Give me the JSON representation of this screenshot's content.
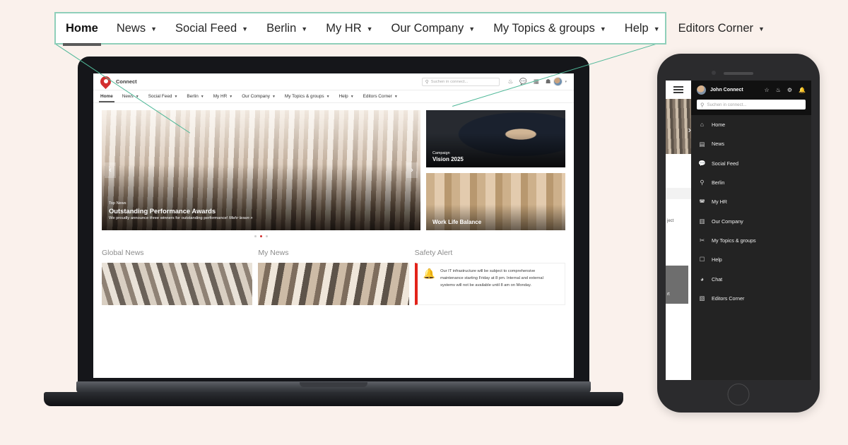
{
  "theme": {
    "page_background": "#faf1ec",
    "callout_border": "#8fcfba",
    "leader_line": "#4fb898",
    "brand_red": "#d32f2f",
    "alert_red": "#e2231a"
  },
  "callout_nav": {
    "items": [
      {
        "label": "Home",
        "caret": "",
        "active": true
      },
      {
        "label": "News",
        "caret": "▼",
        "active": false
      },
      {
        "label": "Social Feed",
        "caret": "▼",
        "active": false
      },
      {
        "label": "Berlin",
        "caret": "▼",
        "active": false
      },
      {
        "label": "My HR",
        "caret": "▼",
        "active": false
      },
      {
        "label": "Our Company",
        "caret": "▼",
        "active": false
      },
      {
        "label": "My Topics & groups",
        "caret": "▼",
        "active": false
      },
      {
        "label": "Help",
        "caret": "▼",
        "active": false
      },
      {
        "label": "Editors Corner",
        "caret": "▼",
        "active": false
      }
    ]
  },
  "desktop": {
    "header": {
      "brand": "Connect",
      "logo_icon": "location-pin-icon",
      "search_placeholder": "Suchen in connect...",
      "search_icon": "search-icon",
      "icons": [
        {
          "name": "people-icon",
          "glyph": "⚇"
        },
        {
          "name": "chat-icon",
          "glyph": "○"
        },
        {
          "name": "apps-grid-icon",
          "glyph": "∷"
        },
        {
          "name": "bookmark-icon",
          "glyph": "⌂"
        }
      ],
      "avatar_caret": "▾"
    },
    "nav": {
      "items": [
        {
          "label": "Home",
          "caret": "",
          "active": true
        },
        {
          "label": "News",
          "caret": "▼",
          "active": false
        },
        {
          "label": "Social Feed",
          "caret": "▼",
          "active": false
        },
        {
          "label": "Berlin",
          "caret": "▼",
          "active": false
        },
        {
          "label": "My HR",
          "caret": "▼",
          "active": false
        },
        {
          "label": "Our Company",
          "caret": "▼",
          "active": false
        },
        {
          "label": "My Topics & groups",
          "caret": "▼",
          "active": false
        },
        {
          "label": "Help",
          "caret": "▼",
          "active": false
        },
        {
          "label": "Editors Corner",
          "caret": "▼",
          "active": false
        }
      ]
    },
    "hero": {
      "prev_arrow": "‹",
      "next_arrow": "›",
      "kicker": "Top News",
      "title": "Outstanding Performance Awards",
      "subtitle": "We proudly announce three winners for outstanding performance!",
      "link": "Mehr lesen »",
      "dots": 3,
      "active_dot": 1
    },
    "cards": [
      {
        "kicker": "Campaign",
        "title": "Vision 2025"
      },
      {
        "kicker": "",
        "title": "Work Life Balance"
      }
    ],
    "sections": [
      {
        "heading": "Global News"
      },
      {
        "heading": "My News"
      },
      {
        "heading": "Safety Alert"
      }
    ],
    "safety_alert": {
      "icon": "bell-icon",
      "text": "Our IT infrastructure will be subject to comprehensive maintenance starting Friday at 8 pm. Internal and external systems will not be available until 8 am on Monday."
    }
  },
  "mobile": {
    "hamburger_icon": "hamburger-menu-icon",
    "behind_text": "ject",
    "behind_dark_text": "rt",
    "behind_chevron": "›",
    "topbar": {
      "avatar": "user-avatar",
      "user": "John Connect",
      "icons": [
        {
          "name": "star-icon",
          "glyph": "☆"
        },
        {
          "name": "people-icon",
          "glyph": "⚇"
        },
        {
          "name": "gear-icon",
          "glyph": "⚙"
        },
        {
          "name": "bell-icon",
          "glyph": "☂"
        }
      ]
    },
    "search_placeholder": "Suchen in connect...",
    "search_icon": "search-icon",
    "menu_items": [
      {
        "label": "Home",
        "icon": "home-icon",
        "glyph": "⌂"
      },
      {
        "label": "News",
        "icon": "newspaper-icon",
        "glyph": "▤"
      },
      {
        "label": "Social Feed",
        "icon": "speech-bubble-icon",
        "glyph": "◯"
      },
      {
        "label": "Berlin",
        "icon": "location-pin-icon",
        "glyph": "⚲"
      },
      {
        "label": "My HR",
        "icon": "person-badge-icon",
        "glyph": "⊚"
      },
      {
        "label": "Our Company",
        "icon": "building-icon",
        "glyph": "▥"
      },
      {
        "label": "My Topics & groups",
        "icon": "scissors-topics-icon",
        "glyph": "✂"
      },
      {
        "label": "Help",
        "icon": "folder-icon",
        "glyph": "□"
      },
      {
        "label": "Chat",
        "icon": "chat-icon",
        "glyph": "◔"
      },
      {
        "label": "Editors Corner",
        "icon": "edit-square-icon",
        "glyph": "▧"
      }
    ]
  }
}
